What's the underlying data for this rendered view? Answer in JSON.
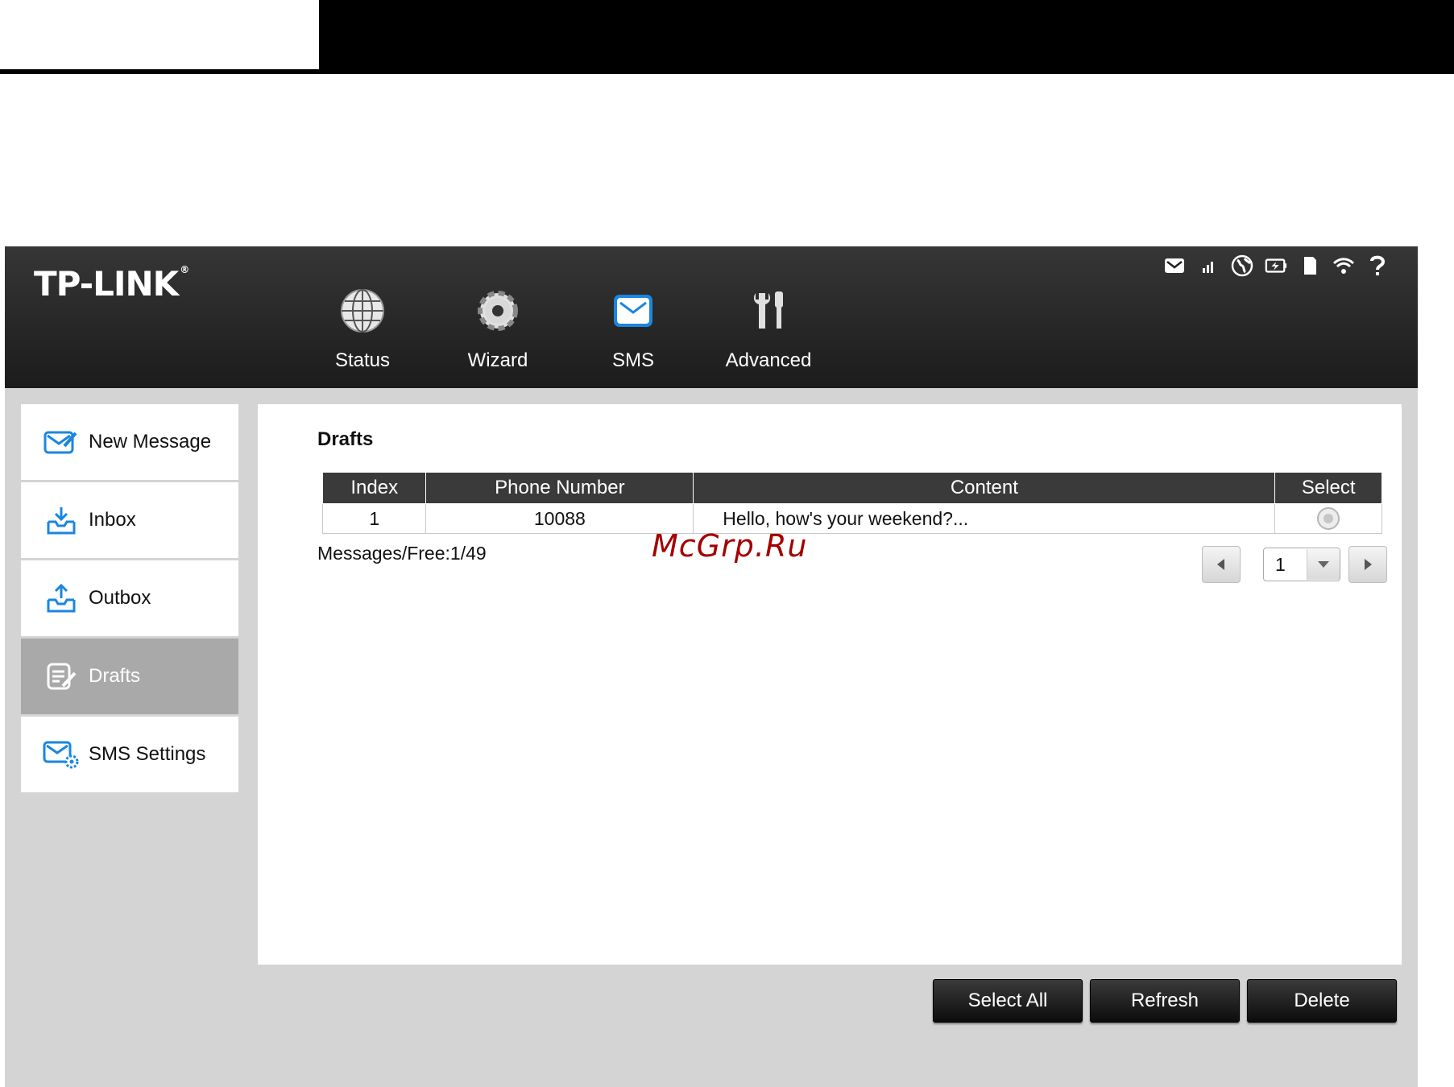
{
  "brand": {
    "logo_text": "TP-LINK"
  },
  "status_icons": [
    "sms-icon",
    "signal-icon",
    "internet-icon",
    "battery-icon",
    "sd-card-icon",
    "wifi-icon",
    "help-icon"
  ],
  "nav": [
    {
      "label": "Status",
      "icon": "globe-icon"
    },
    {
      "label": "Wizard",
      "icon": "gear-icon"
    },
    {
      "label": "SMS",
      "icon": "envelope-icon",
      "active": true
    },
    {
      "label": "Advanced",
      "icon": "tools-icon"
    }
  ],
  "sidebar": {
    "items": [
      {
        "label": "New Message",
        "icon": "new-message-icon"
      },
      {
        "label": "Inbox",
        "icon": "inbox-icon"
      },
      {
        "label": "Outbox",
        "icon": "outbox-icon"
      },
      {
        "label": "Drafts",
        "icon": "drafts-icon",
        "active": true
      },
      {
        "label": "SMS Settings",
        "icon": "sms-settings-icon"
      }
    ]
  },
  "main": {
    "title": "Drafts",
    "table": {
      "headers": [
        "Index",
        "Phone Number",
        "Content",
        "Select"
      ],
      "rows": [
        {
          "index": "1",
          "phone": "10088",
          "content": "Hello, how's your weekend?..."
        }
      ]
    },
    "messages_free": "Messages/Free:1/49",
    "page_value": "1"
  },
  "watermark": "McGrp.Ru",
  "actions": {
    "select_all": "Select All",
    "refresh": "Refresh",
    "delete": "Delete"
  },
  "colors": {
    "header_bg": "#2a2a2a",
    "accent_blue": "#1a86e0",
    "active_sidebar": "#a9a9a9",
    "panel_bg": "#d4d4d4"
  }
}
